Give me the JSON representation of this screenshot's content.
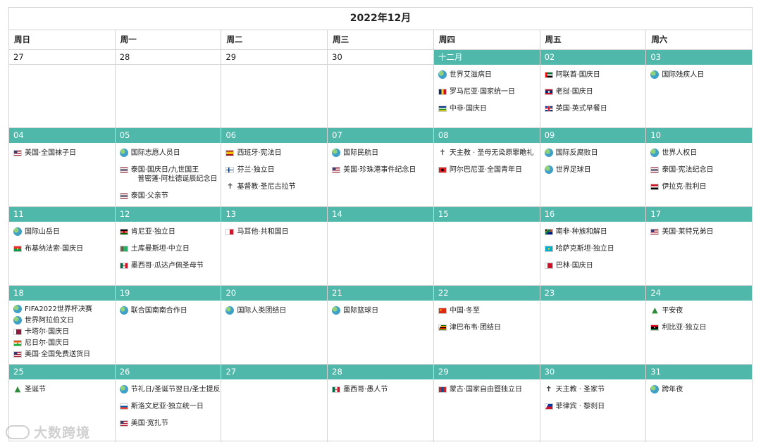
{
  "calendar": {
    "title": "2022年12月",
    "weekdays": [
      "周日",
      "周一",
      "周二",
      "周三",
      "周四",
      "周五",
      "周六"
    ],
    "weeks": [
      [
        {
          "day": "27",
          "style": "plain",
          "events": []
        },
        {
          "day": "28",
          "style": "plain",
          "events": []
        },
        {
          "day": "29",
          "style": "plain",
          "events": []
        },
        {
          "day": "30",
          "style": "plain",
          "events": []
        },
        {
          "day": "十二月",
          "style": "teal",
          "events": [
            {
              "icon": "globe-icon",
              "text": "世界艾滋病日"
            },
            {
              "icon": "flag-romania-icon",
              "text": "罗马尼亚·国家统一日"
            },
            {
              "icon": "flag-central-african-republic-icon",
              "text": "中非·国庆日"
            }
          ]
        },
        {
          "day": "02",
          "style": "teal",
          "events": [
            {
              "icon": "flag-uae-icon",
              "text": "阿联酋·国庆日"
            },
            {
              "icon": "flag-laos-icon",
              "text": "老挝·国庆日"
            },
            {
              "icon": "flag-uk-icon",
              "text": "英国·英式早餐日"
            }
          ]
        },
        {
          "day": "03",
          "style": "teal",
          "events": [
            {
              "icon": "globe-icon",
              "text": "国际残疾人日"
            }
          ]
        }
      ],
      [
        {
          "day": "04",
          "style": "teal",
          "events": [
            {
              "icon": "flag-usa-icon",
              "text": "美国·全国袜子日"
            }
          ]
        },
        {
          "day": "05",
          "style": "teal",
          "events": [
            {
              "icon": "globe-icon",
              "text": "国际志愿人员日"
            },
            {
              "icon": "flag-thailand-icon",
              "text": "泰国·国庆日/九世国王\n   普密蓬·阿杜德诞辰纪念日"
            },
            {
              "icon": "flag-thailand-icon",
              "text": "泰国·父亲节"
            }
          ]
        },
        {
          "day": "06",
          "style": "teal",
          "events": [
            {
              "icon": "flag-spain-icon",
              "text": "西班牙·宪法日"
            },
            {
              "icon": "flag-finland-icon",
              "text": "芬兰·独立日"
            },
            {
              "icon": "cross-icon",
              "text": "基督教·圣尼古拉节"
            }
          ]
        },
        {
          "day": "07",
          "style": "teal",
          "events": [
            {
              "icon": "globe-icon",
              "text": "国际民航日"
            },
            {
              "icon": "flag-usa-icon",
              "text": "美国·珍珠港事件纪念日"
            }
          ]
        },
        {
          "day": "08",
          "style": "teal",
          "events": [
            {
              "icon": "cross-icon",
              "text": "天主教 · 圣母无染原罪瞻礼"
            },
            {
              "icon": "flag-albania-icon",
              "text": "阿尔巴尼亚·全国青年日"
            }
          ]
        },
        {
          "day": "09",
          "style": "teal",
          "events": [
            {
              "icon": "globe-icon",
              "text": "国际反腐败日"
            },
            {
              "icon": "globe-icon",
              "text": "世界足球日"
            }
          ]
        },
        {
          "day": "10",
          "style": "teal",
          "events": [
            {
              "icon": "globe-icon",
              "text": "世界人权日"
            },
            {
              "icon": "flag-thailand-icon",
              "text": "泰国·宪法纪念日"
            },
            {
              "icon": "flag-iraq-icon",
              "text": "伊拉克·胜利日"
            }
          ]
        }
      ],
      [
        {
          "day": "11",
          "style": "teal",
          "events": [
            {
              "icon": "globe-icon",
              "text": "国际山岳日"
            },
            {
              "icon": "flag-burkina-faso-icon",
              "text": "布基纳法索·国庆日"
            }
          ]
        },
        {
          "day": "12",
          "style": "teal",
          "events": [
            {
              "icon": "flag-kenya-icon",
              "text": "肯尼亚·独立日"
            },
            {
              "icon": "flag-turkmenistan-icon",
              "text": "土库曼斯坦·中立日"
            },
            {
              "icon": "flag-mexico-icon",
              "text": "墨西哥·瓜达卢佩圣母节"
            }
          ]
        },
        {
          "day": "13",
          "style": "teal",
          "events": [
            {
              "icon": "flag-malta-icon",
              "text": "马耳他·共和国日"
            }
          ]
        },
        {
          "day": "14",
          "style": "teal",
          "events": []
        },
        {
          "day": "15",
          "style": "teal",
          "events": []
        },
        {
          "day": "16",
          "style": "teal",
          "events": [
            {
              "icon": "flag-south-africa-icon",
              "text": "南非·种族和解日"
            },
            {
              "icon": "flag-kazakhstan-icon",
              "text": "哈萨克斯坦·独立日"
            },
            {
              "icon": "flag-bahrain-icon",
              "text": "巴林·国庆日"
            }
          ]
        },
        {
          "day": "17",
          "style": "teal",
          "events": [
            {
              "icon": "flag-usa-icon",
              "text": "美国·莱特兄弟日"
            }
          ]
        }
      ],
      [
        {
          "day": "18",
          "style": "teal",
          "tight": true,
          "events": [
            {
              "icon": "globe-icon",
              "text": "FIFA2022世界杯决赛"
            },
            {
              "icon": "globe-icon",
              "text": "世界阿拉伯文日"
            },
            {
              "icon": "flag-qatar-icon",
              "text": "卡塔尔·国庆日"
            },
            {
              "icon": "flag-niger-icon",
              "text": "尼日尔·国庆日"
            },
            {
              "icon": "flag-usa-icon",
              "text": "美国·全国免费送货日"
            }
          ]
        },
        {
          "day": "19",
          "style": "teal",
          "events": [
            {
              "icon": "globe-icon",
              "text": "联合国南南合作日"
            }
          ]
        },
        {
          "day": "20",
          "style": "teal",
          "events": [
            {
              "icon": "globe-icon",
              "text": "国际人类团结日"
            }
          ]
        },
        {
          "day": "21",
          "style": "teal",
          "events": [
            {
              "icon": "globe-icon",
              "text": "国际篮球日"
            }
          ]
        },
        {
          "day": "22",
          "style": "teal",
          "events": [
            {
              "icon": "flag-china-icon",
              "text": "中国·冬至"
            },
            {
              "icon": "flag-zimbabwe-icon",
              "text": "津巴布韦·团结日"
            }
          ]
        },
        {
          "day": "23",
          "style": "teal",
          "events": []
        },
        {
          "day": "24",
          "style": "teal",
          "events": [
            {
              "icon": "christmas-tree-icon",
              "text": "平安夜"
            },
            {
              "icon": "flag-libya-icon",
              "text": "利比亚·独立日"
            }
          ]
        }
      ],
      [
        {
          "day": "25",
          "style": "teal",
          "events": [
            {
              "icon": "christmas-tree-icon",
              "text": "圣诞节"
            }
          ]
        },
        {
          "day": "26",
          "style": "teal",
          "events": [
            {
              "icon": "globe-icon",
              "text": "节礼日/圣诞节翌日/圣士提反日"
            },
            {
              "icon": "flag-slovenia-icon",
              "text": "斯洛文尼亚·独立统一日"
            },
            {
              "icon": "flag-usa-icon",
              "text": "美国·宽扎节"
            }
          ]
        },
        {
          "day": "27",
          "style": "teal",
          "events": []
        },
        {
          "day": "28",
          "style": "teal",
          "events": [
            {
              "icon": "flag-mexico-icon",
              "text": "墨西哥·愚人节"
            }
          ]
        },
        {
          "day": "29",
          "style": "teal",
          "events": [
            {
              "icon": "flag-mongolia-icon",
              "text": "蒙古·国家自由暨独立日"
            }
          ]
        },
        {
          "day": "30",
          "style": "teal",
          "events": [
            {
              "icon": "cross-icon",
              "text": "天主教 · 圣家节"
            },
            {
              "icon": "flag-philippines-icon",
              "text": "菲律宾 · 黎刹日"
            }
          ]
        },
        {
          "day": "31",
          "style": "teal",
          "events": [
            {
              "icon": "globe-icon",
              "text": "跨年夜"
            }
          ]
        }
      ]
    ]
  },
  "watermark": {
    "text": "大数跨境"
  },
  "colors": {
    "header_teal": "#4fb8aa",
    "border": "#d4d4d4"
  }
}
